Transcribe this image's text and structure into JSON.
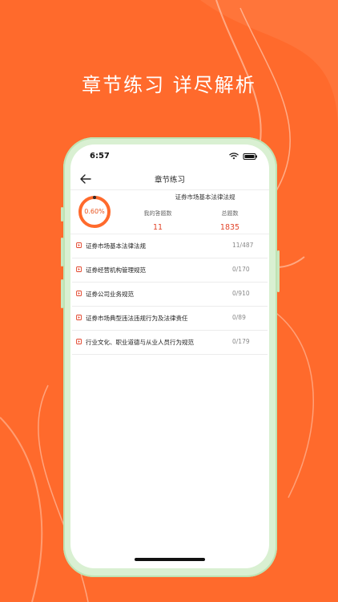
{
  "headline": "章节练习  详尽解析",
  "colors": {
    "background": "#ff6a2c",
    "accent": "#e2442a",
    "ring": "#ff6a2c"
  },
  "status_bar": {
    "time": "6:57"
  },
  "nav": {
    "back_icon": "arrow-left-icon",
    "title": "章节练习"
  },
  "summary": {
    "title": "证券市场基本法律法规",
    "progress_percent": 0.6,
    "progress_text": "0.60%",
    "answered_label": "我的答题数",
    "answered_value": "11",
    "total_label": "总题数",
    "total_value": "1835"
  },
  "chapters": [
    {
      "label": "证券市场基本法律法规",
      "count": "11/487"
    },
    {
      "label": "证券经营机构管理规范",
      "count": "0/170"
    },
    {
      "label": "证券公司业务规范",
      "count": "0/910"
    },
    {
      "label": "证券市场典型违法违规行为及法律责任",
      "count": "0/89"
    },
    {
      "label": "行业文化、职业道德与从业人员行为规范",
      "count": "0/179"
    }
  ]
}
